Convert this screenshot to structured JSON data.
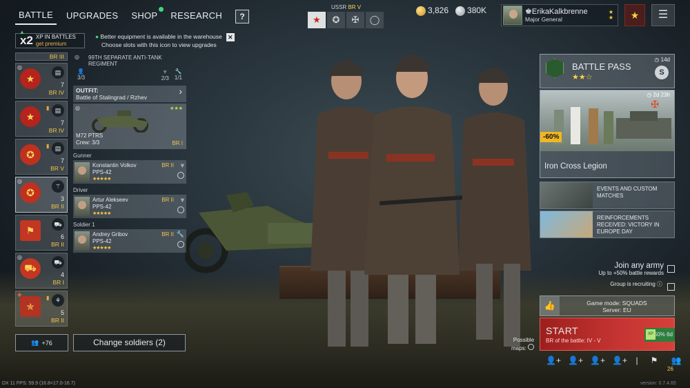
{
  "nav": {
    "tabs": [
      {
        "label": "BATTLE",
        "active": true
      },
      {
        "label": "UPGRADES"
      },
      {
        "label": "SHOP",
        "badge": true
      },
      {
        "label": "RESEARCH"
      }
    ],
    "help_label": "?"
  },
  "xp_banner": {
    "multiplier": "x2",
    "line1": "XP IN BATTLES",
    "line2": "get premium"
  },
  "notice": {
    "line1": "Better equipment is available in the warehouse",
    "line2": "Choose slots with this icon to view upgrades"
  },
  "nation": {
    "label": "USSR",
    "br": "BR V",
    "tabs": [
      "star-icon",
      "cross-icon",
      "iron-cross-icon",
      "ring-icon"
    ]
  },
  "currency": {
    "gold": "3,826",
    "silver": "380K"
  },
  "profile": {
    "name": "ErikaKalkbrenne",
    "rank": "Major General"
  },
  "squads": [
    {
      "br": "BR III",
      "partial": true
    },
    {
      "br": "BR IV",
      "count": "7",
      "tiny": "",
      "emblem_num": "926"
    },
    {
      "br": "BR IV",
      "count": "7",
      "emblem_num": "21"
    },
    {
      "br": "BR V",
      "count": "7",
      "emblem_num": "91"
    },
    {
      "br": "BR II",
      "count": "3",
      "emblem_num": "99"
    },
    {
      "br": "BR II",
      "count": "6",
      "emblem_num": "5"
    },
    {
      "br": "BR I",
      "count": "4",
      "emblem_num": "19"
    },
    {
      "br": "BR II",
      "count": "5",
      "emblem_num": ""
    }
  ],
  "reinforce": {
    "label": "+76"
  },
  "change_soldiers": {
    "label": "Change soldiers (2)"
  },
  "regiment": {
    "title": "99TH SEPARATE ANTI-TANK REGIMENT",
    "left_count": "3/3",
    "mid_count": "2/3",
    "right_count": "1/1",
    "outfit_label": "OUTFIT:",
    "outfit_value": "Battle of Stalingrad / Rzhev",
    "vehicle": {
      "name": "M72 PTRS",
      "crew": "Crew: 3/3",
      "br": "BR I",
      "stars": "★★★"
    },
    "crew": [
      {
        "role": "Gunner",
        "name": "Konstantin Volkov",
        "weapon": "PPS-42",
        "br": "BR II"
      },
      {
        "role": "Driver",
        "name": "Artur Alekseev",
        "weapon": "PPS-42",
        "br": "BR II"
      },
      {
        "role": "Soldier 1",
        "name": "Andrey Gribov",
        "weapon": "PPS-42",
        "br": "BR II"
      }
    ],
    "crew_stars": "★★★★★"
  },
  "battle_pass": {
    "title": "BATTLE PASS",
    "stars": "★★☆",
    "timer": "14d",
    "season_label": "S"
  },
  "event": {
    "discount": "-60%",
    "timer": "2d 23h",
    "name": "Iron Cross Legion"
  },
  "promos": [
    {
      "text": "EVENTS AND CUSTOM MATCHES"
    },
    {
      "text": "REINFORCEMENTS RECEIVED: VICTORY IN EUROPE DAY"
    }
  ],
  "join": {
    "title": "Join any army",
    "sub": "Up to +50% battle rewards",
    "group": "Group is recruiting"
  },
  "mode": {
    "line1": "Game mode: SQUADS",
    "line2": "Server: EU"
  },
  "start": {
    "label": "START",
    "sub": "BR of the battle: IV - V",
    "xp": "+50% 6d",
    "xp_icon": "XP"
  },
  "possible_maps": {
    "line1": "Possible",
    "line2": "maps:"
  },
  "bottom": {
    "count": "26"
  },
  "debug": {
    "fps": "DX 11 FPS: 59.9 (16.8<17.0-16.7)",
    "version": "version: 0.7.4.65"
  },
  "colors": {
    "accent_red": "#c63532",
    "br_gold": "#f0c44b",
    "premium_green": "#3fd77a"
  }
}
